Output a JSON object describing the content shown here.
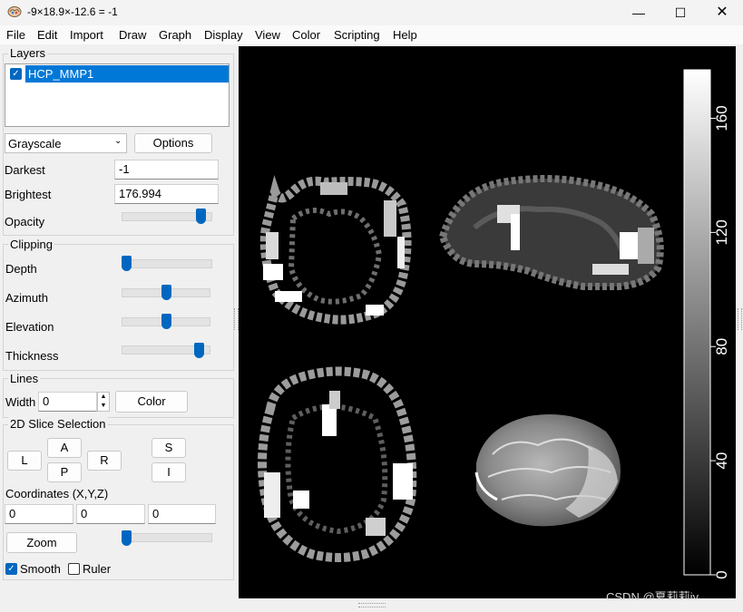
{
  "window": {
    "title": "-9×18.9×-12.6 =   -1"
  },
  "menu": [
    "File",
    "Edit",
    "Import",
    "Draw",
    "Graph",
    "Display",
    "View",
    "Color",
    "Scripting",
    "Help"
  ],
  "layers": {
    "label": "Layers",
    "items": [
      {
        "name": "HCP_MMP1",
        "checked": true
      }
    ]
  },
  "colormap": {
    "selected": "Grayscale",
    "options_button": "Options"
  },
  "darkest": {
    "label": "Darkest",
    "value": "-1"
  },
  "brightest": {
    "label": "Brightest",
    "value": "176.994"
  },
  "opacity": {
    "label": "Opacity",
    "level": 0.92
  },
  "clipping": {
    "label": "Clipping",
    "depth": {
      "label": "Depth",
      "level": 0.0
    },
    "azimuth": {
      "label": "Azimuth",
      "level": 0.5
    },
    "elevation": {
      "label": "Elevation",
      "level": 0.5
    },
    "thickness": {
      "label": "Thickness",
      "level": 0.92
    }
  },
  "lines": {
    "label": "Lines",
    "width_label": "Width",
    "width_value": "0",
    "color_button": "Color"
  },
  "slice": {
    "label": "2D Slice Selection",
    "buttons": {
      "L": "L",
      "A": "A",
      "P": "P",
      "R": "R",
      "S": "S",
      "I": "I"
    },
    "coords_label": "Coordinates (X,Y,Z)",
    "x": "0",
    "y": "0",
    "z": "0",
    "zoom_button": "Zoom",
    "zoom_level": 0.0,
    "smooth_label": "Smooth",
    "smooth_checked": true,
    "ruler_label": "Ruler",
    "ruler_checked": false
  },
  "colorbar": {
    "ticks": [
      "0",
      "40",
      "80",
      "120",
      "160"
    ]
  },
  "watermark": "CSDN @夏莉莉iy"
}
